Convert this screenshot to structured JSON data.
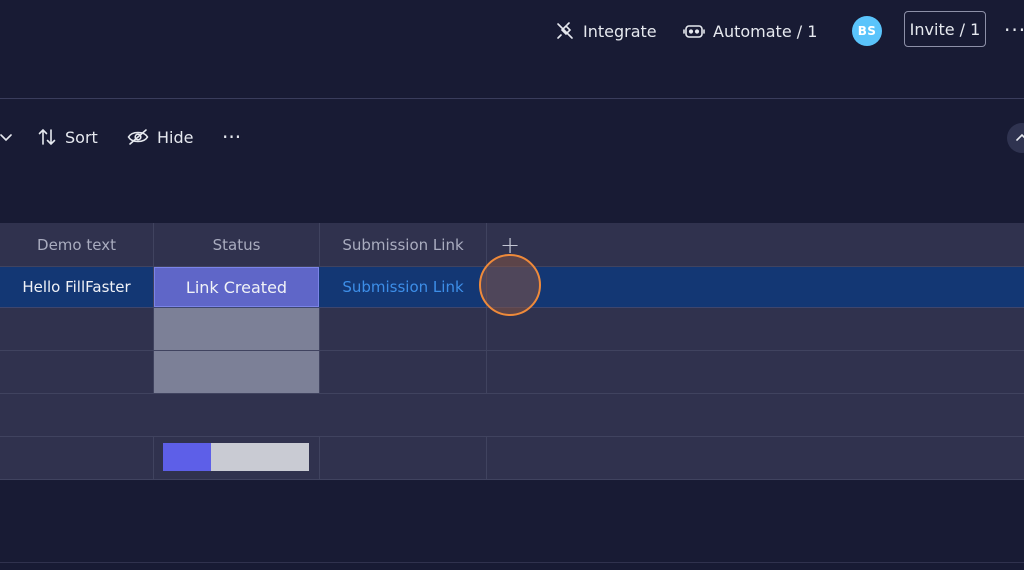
{
  "header": {
    "integrate_label": "Integrate",
    "automate_label": "Automate / 1",
    "avatar_initials": "BS",
    "invite_label": "Invite / 1",
    "more_label": "···"
  },
  "toolbar": {
    "sort_label": "Sort",
    "hide_label": "Hide",
    "more_label": "···"
  },
  "table": {
    "columns": [
      "Demo text",
      "Status",
      "Submission Link"
    ],
    "add_column_label": "+",
    "rows": [
      {
        "demo_text": "Hello FillFaster",
        "status": "Link Created",
        "submission_link": "Submission Link"
      }
    ],
    "summary_progress": {
      "done_fraction": 0.33
    }
  },
  "colors": {
    "background": "#181b34",
    "selected_row": "#133774",
    "status_chip": "#5f66c8",
    "link": "#3d8ee8",
    "avatar": "#5ac4fb",
    "cursor_ring": "#ef8a3a"
  }
}
